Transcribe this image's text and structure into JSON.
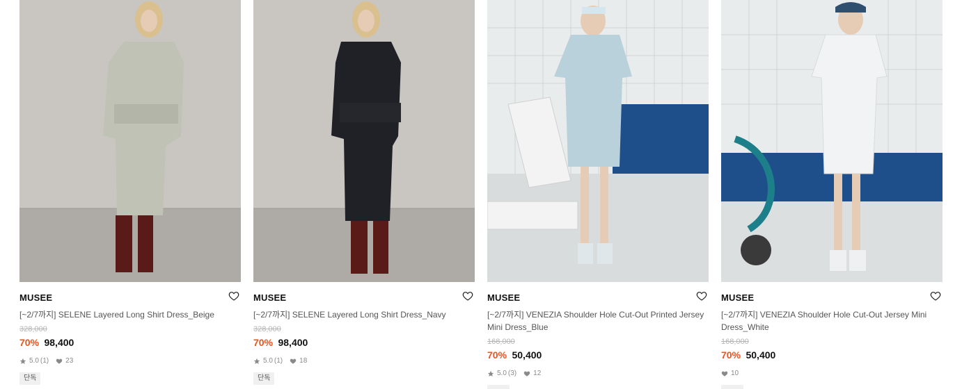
{
  "products": [
    {
      "brand": "MUSEE",
      "title": "[~2/7까지] SELENE Layered Long Shirt Dress_Beige",
      "original_price": "328,000",
      "discount": "70%",
      "price": "98,400",
      "rating": "5.0",
      "review_count": "(1)",
      "likes": "23",
      "badge": "단독",
      "image": "model-beige-dress"
    },
    {
      "brand": "MUSEE",
      "title": "[~2/7까지] SELENE Layered Long Shirt Dress_Navy",
      "original_price": "328,000",
      "discount": "70%",
      "price": "98,400",
      "rating": "5.0",
      "review_count": "(1)",
      "likes": "18",
      "badge": "단독",
      "image": "model-navy-dress"
    },
    {
      "brand": "MUSEE",
      "title": "[~2/7까지] VENEZIA Shoulder Hole Cut-Out Printed Jersey Mini Dress_Blue",
      "original_price": "168,000",
      "discount": "70%",
      "price": "50,400",
      "rating": "5.0",
      "review_count": "(3)",
      "likes": "12",
      "badge": "",
      "image": "model-blue-mini-dress"
    },
    {
      "brand": "MUSEE",
      "title": "[~2/7까지] VENEZIA Shoulder Hole Cut-Out Jersey Mini Dress_White",
      "original_price": "168,000",
      "discount": "70%",
      "price": "50,400",
      "rating": "",
      "review_count": "",
      "likes": "10",
      "badge": "",
      "image": "model-white-mini-dress"
    }
  ],
  "colors": {
    "discount": "#e8541d",
    "studio_wall": "#c9c6c1",
    "studio_floor": "#aeaba7",
    "pool_tile": "#e9ecec",
    "pool_blue": "#1f4f8a"
  },
  "icons": {
    "like": "heart-outline-icon",
    "rating": "star-icon",
    "likes": "heart-filled-icon"
  }
}
